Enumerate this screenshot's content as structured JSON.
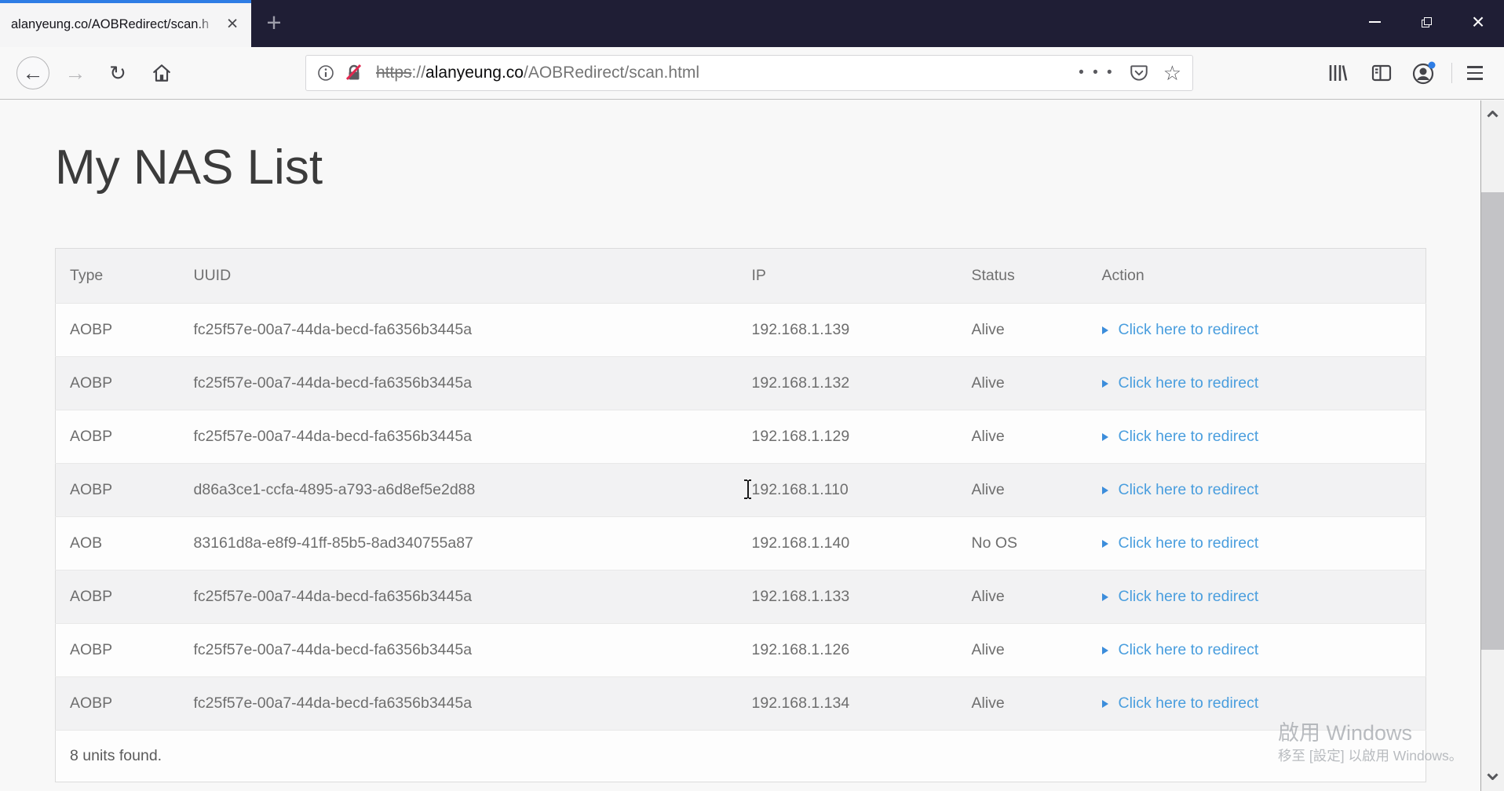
{
  "browser": {
    "tab": {
      "title": "alanyeung.co/AOBRedirect/scan.h"
    },
    "url": {
      "scheme": "https",
      "separator": "://",
      "host": "alanyeung.co",
      "path": "/AOBRedirect/scan.html"
    },
    "icons": {
      "tab_close": "×",
      "new_tab": "+",
      "back": "←",
      "forward": "→",
      "reload": "↻",
      "page_actions_dots": "• • •",
      "bookmark_star": "☆"
    }
  },
  "page": {
    "title": "My NAS List",
    "table": {
      "headers": [
        "Type",
        "UUID",
        "IP",
        "Status",
        "Action"
      ],
      "rows": [
        {
          "type": "AOBP",
          "uuid": "fc25f57e-00a7-44da-becd-fa6356b3445a",
          "ip": "192.168.1.139",
          "status": "Alive",
          "action": "Click here to redirect"
        },
        {
          "type": "AOBP",
          "uuid": "fc25f57e-00a7-44da-becd-fa6356b3445a",
          "ip": "192.168.1.132",
          "status": "Alive",
          "action": "Click here to redirect"
        },
        {
          "type": "AOBP",
          "uuid": "fc25f57e-00a7-44da-becd-fa6356b3445a",
          "ip": "192.168.1.129",
          "status": "Alive",
          "action": "Click here to redirect"
        },
        {
          "type": "AOBP",
          "uuid": "d86a3ce1-ccfa-4895-a793-a6d8ef5e2d88",
          "ip": "192.168.1.110",
          "status": "Alive",
          "action": "Click here to redirect"
        },
        {
          "type": "AOB",
          "uuid": "83161d8a-e8f9-41ff-85b5-8ad340755a87",
          "ip": "192.168.1.140",
          "status": "No OS",
          "action": "Click here to redirect"
        },
        {
          "type": "AOBP",
          "uuid": "fc25f57e-00a7-44da-becd-fa6356b3445a",
          "ip": "192.168.1.133",
          "status": "Alive",
          "action": "Click here to redirect"
        },
        {
          "type": "AOBP",
          "uuid": "fc25f57e-00a7-44da-becd-fa6356b3445a",
          "ip": "192.168.1.126",
          "status": "Alive",
          "action": "Click here to redirect"
        },
        {
          "type": "AOBP",
          "uuid": "fc25f57e-00a7-44da-becd-fa6356b3445a",
          "ip": "192.168.1.134",
          "status": "Alive",
          "action": "Click here to redirect"
        }
      ],
      "footer": "8 units found."
    },
    "watermark": {
      "line1": "啟用 Windows",
      "line2": "移至 [設定] 以啟用 Windows。"
    }
  },
  "colors": {
    "titlebar_bg": "#1f1e35",
    "active_tab_line": "#2e7de5",
    "link_blue": "#4a9ede",
    "lock_slash_red": "#e22850",
    "page_bg": "#f8f8f8"
  }
}
